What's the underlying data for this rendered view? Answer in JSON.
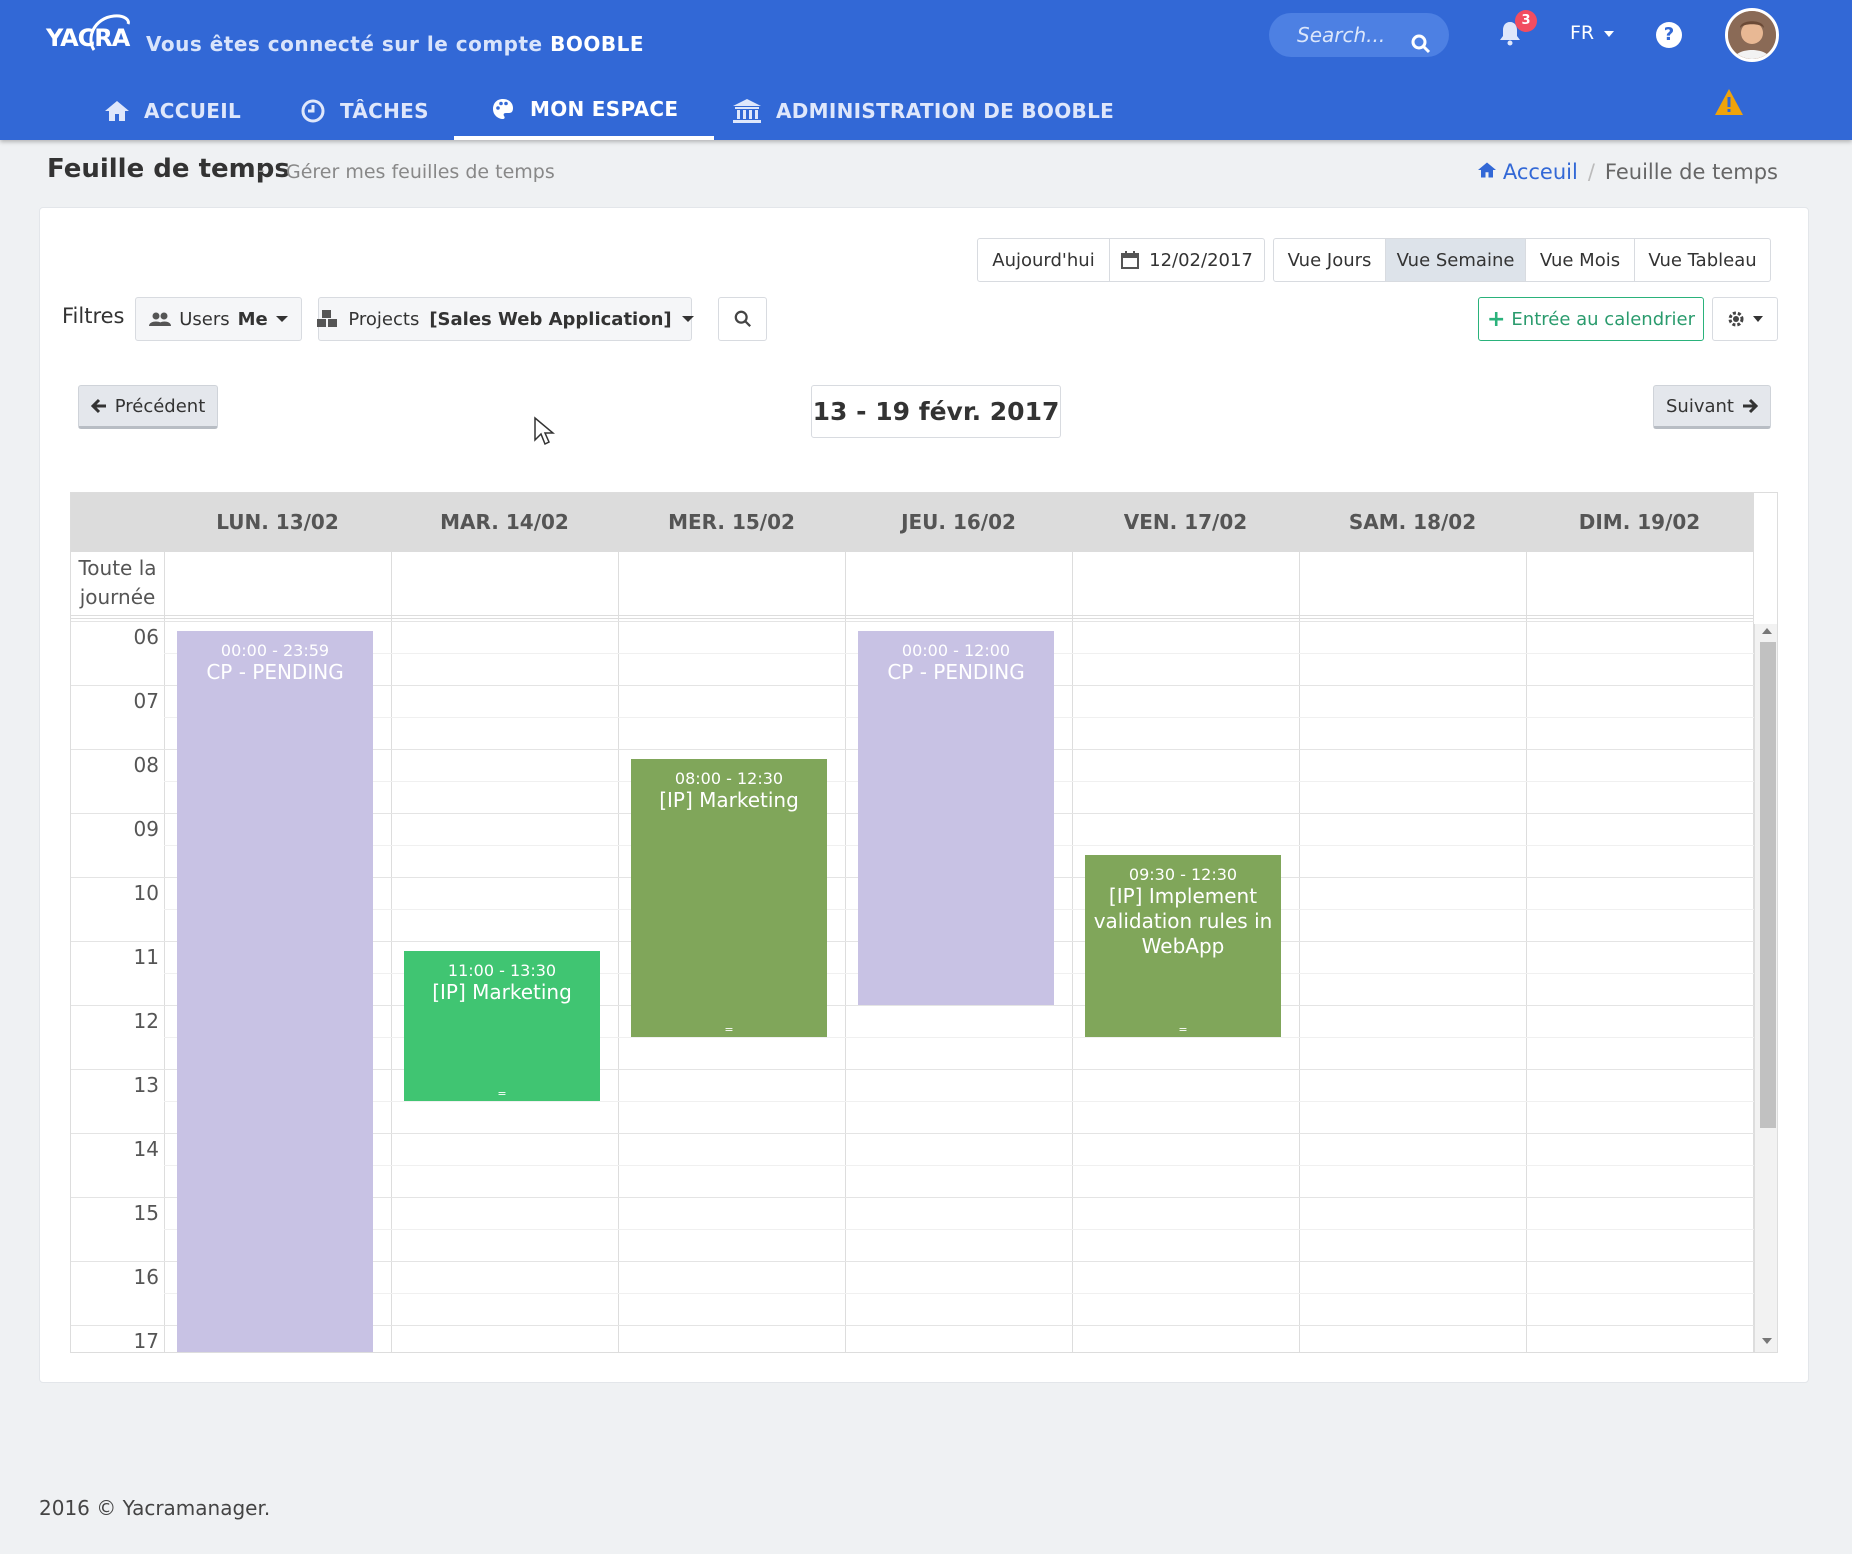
{
  "header": {
    "logo_text": "YACRA",
    "account_prefix": "Vous êtes connecté sur le compte",
    "account_name": "BOOBLE",
    "search_placeholder": "Search...",
    "notification_count": "3",
    "language": "FR",
    "help_label": "?"
  },
  "nav": {
    "items": [
      {
        "label": "ACCUEIL",
        "icon": "home-icon"
      },
      {
        "label": "TÂCHES",
        "icon": "clock-icon"
      },
      {
        "label": "MON ESPACE",
        "icon": "palette-icon",
        "active": true
      },
      {
        "label": "ADMINISTRATION DE BOOBLE",
        "icon": "bank-icon"
      }
    ]
  },
  "page": {
    "title": "Feuille de temps",
    "separator": "-",
    "subtitle": "Gérer mes feuilles de temps",
    "breadcrumb_home": "Acceuil",
    "breadcrumb_current": "Feuille de temps"
  },
  "toolbar": {
    "today": "Aujourd'hui",
    "date": "12/02/2017",
    "views": [
      "Vue Jours",
      "Vue Semaine",
      "Vue Mois",
      "Vue Tableau"
    ],
    "active_view": "Vue Semaine"
  },
  "filters": {
    "label": "Filtres",
    "users_label": "Users",
    "users_value": "Me",
    "projects_label": "Projects",
    "projects_value": "[Sales Web Application]",
    "add_entry": "Entrée au calendrier"
  },
  "navigation": {
    "prev": "Précédent",
    "next": "Suivant",
    "week_title": "13 - 19 févr. 2017"
  },
  "calendar": {
    "days": [
      "LUN. 13/02",
      "MAR. 14/02",
      "MER. 15/02",
      "JEU. 16/02",
      "VEN. 17/02",
      "SAM. 18/02",
      "DIM. 19/02"
    ],
    "allday_label": "Toute la journée",
    "hours": [
      "06",
      "07",
      "08",
      "09",
      "10",
      "11",
      "12",
      "13",
      "14",
      "15",
      "16",
      "17"
    ],
    "events": [
      {
        "time": "00:00 - 23:59",
        "title": "CP - PENDING",
        "day": 0
      },
      {
        "time": "11:00 - 13:30",
        "title": "[IP] Marketing",
        "day": 1
      },
      {
        "time": "08:00 - 12:30",
        "title": "[IP] Marketing",
        "day": 2
      },
      {
        "time": "00:00 - 12:00",
        "title": "CP - PENDING",
        "day": 3
      },
      {
        "time": "09:30 - 12:30",
        "title": "[IP] Implement validation rules in WebApp",
        "day": 4
      }
    ],
    "resize_handle": "="
  },
  "colors": {
    "brand": "#3268d6",
    "event_pending": "#c8c2e4",
    "event_green": "#40c572",
    "event_olive": "#80a65a",
    "warning": "#f0a30a"
  },
  "footer": {
    "text": "2016 © Yacramanager."
  }
}
